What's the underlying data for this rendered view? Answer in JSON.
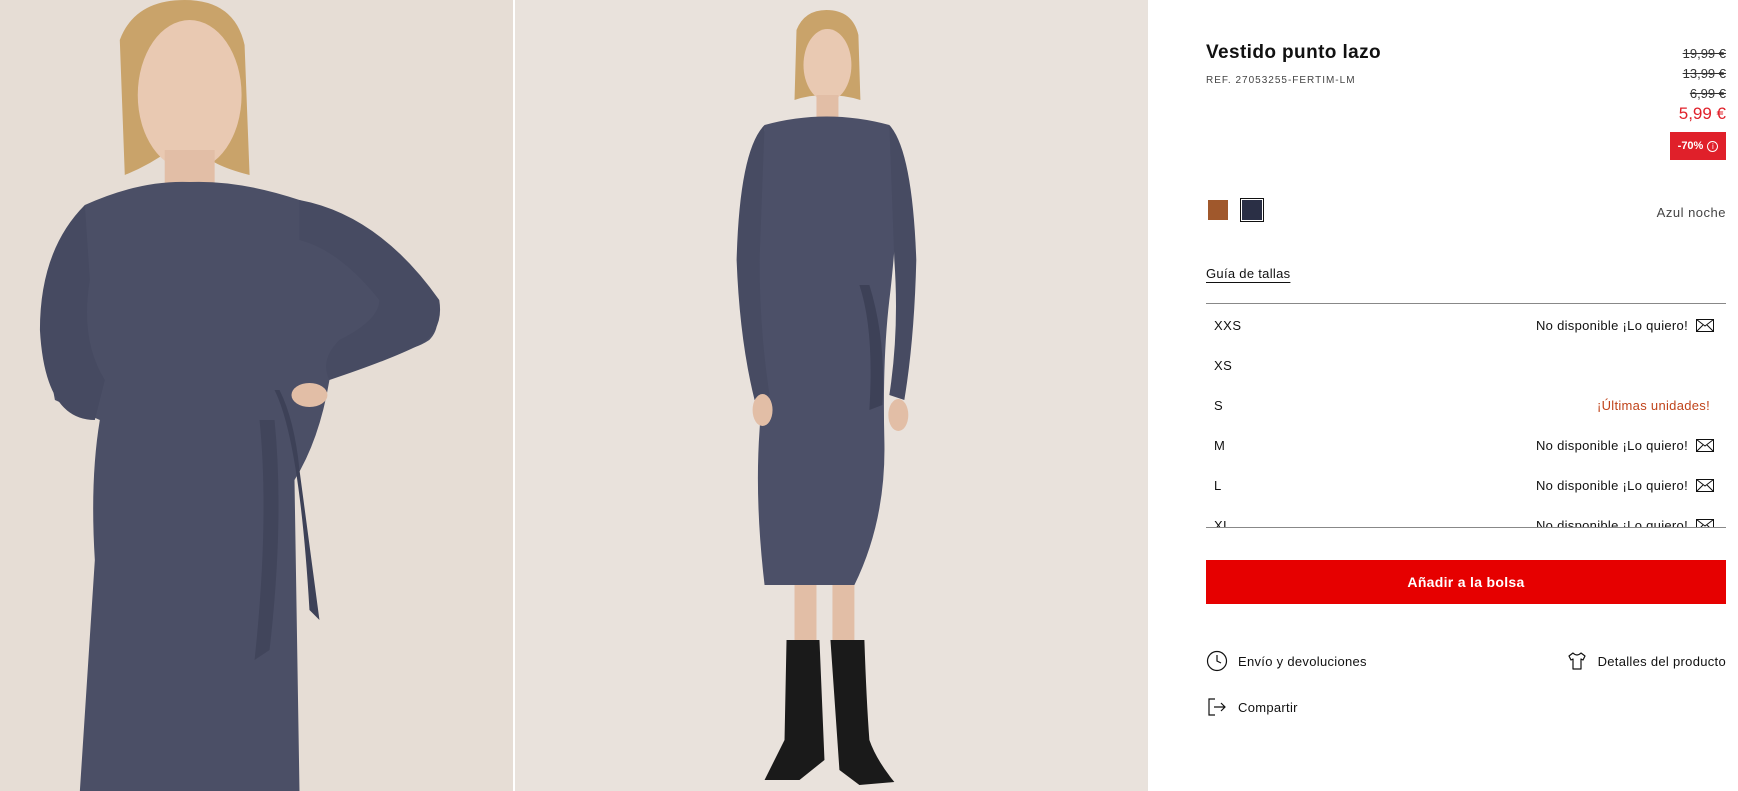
{
  "product": {
    "title": "Vestido punto lazo",
    "ref": "REF. 27053255-FERTIM-LM",
    "prices_old": [
      "19,99 €",
      "13,99 €",
      "6,99 €"
    ],
    "price_current": "5,99 €",
    "discount": "-70%",
    "discount_info_icon": "info-icon"
  },
  "colors": {
    "swatches": [
      {
        "name": "brown",
        "hex": "#a0582c"
      },
      {
        "name": "navy",
        "hex": "#2a2f45"
      }
    ],
    "selected_name": "Azul noche"
  },
  "size_guide": "Guía de tallas",
  "sizes": [
    {
      "label": "XXS",
      "status": "No disponible ¡Lo quiero!",
      "icon": "mail-icon"
    },
    {
      "label": "XS",
      "status": "",
      "icon": ""
    },
    {
      "label": "S",
      "status": "¡Últimas unidades!",
      "icon": ""
    },
    {
      "label": "M",
      "status": "No disponible ¡Lo quiero!",
      "icon": "mail-icon"
    },
    {
      "label": "L",
      "status": "No disponible ¡Lo quiero!",
      "icon": "mail-icon"
    },
    {
      "label": "XL",
      "status": "No disponible ¡Lo quiero!",
      "icon": "mail-icon"
    }
  ],
  "actions": {
    "add_to_bag": "Añadir a la bolsa",
    "shipping": "Envío y devoluciones",
    "details": "Detalles del producto",
    "share": "Compartir"
  },
  "theme": {
    "accent": "#e60000",
    "sale_red": "#e0202a",
    "low_stock": "#c0441b"
  }
}
